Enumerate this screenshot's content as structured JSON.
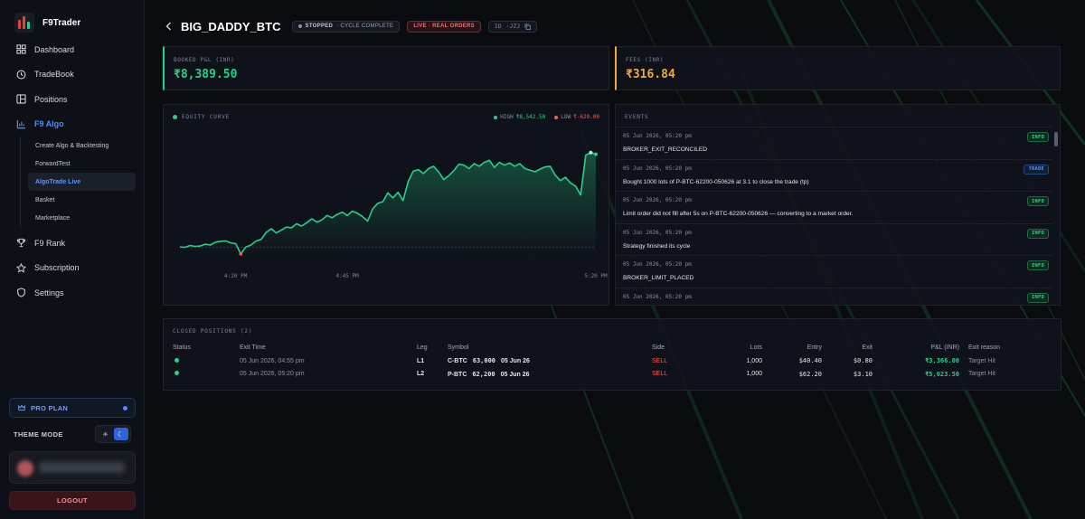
{
  "app": {
    "brand": "F9Trader"
  },
  "colors": {
    "accent": "#4f8cff",
    "profit": "#25d18a",
    "loss": "#ff5a5a",
    "fees": "#f0a93b"
  },
  "sidebar": {
    "items": [
      {
        "label": "Dashboard",
        "icon": "grid-icon"
      },
      {
        "label": "TradeBook",
        "icon": "history-icon"
      },
      {
        "label": "Positions",
        "icon": "layout-icon"
      },
      {
        "label": "F9 Algo",
        "icon": "bar-chart-icon",
        "active": true
      },
      {
        "label": "F9 Rank",
        "icon": "trophy-icon"
      },
      {
        "label": "Subscription",
        "icon": "star-icon"
      },
      {
        "label": "Settings",
        "icon": "shield-icon"
      }
    ],
    "algo_sub": [
      {
        "label": "Create Algo & Backtesting"
      },
      {
        "label": "ForwardTest"
      },
      {
        "label": "AlgoTrade Live",
        "active": true
      },
      {
        "label": "Basket"
      },
      {
        "label": "Marketplace"
      }
    ],
    "pro_plan": "PRO PLAN",
    "theme_mode": "THEME MODE",
    "logout": "LOGOUT"
  },
  "header": {
    "name": "BIG_DADDY_BTC",
    "status": "STOPPED",
    "status_sub": "· CYCLE COMPLETE",
    "live": "LIVE · REAL ORDERS",
    "id_label": "ID",
    "id_value": "·JZJ"
  },
  "kpi": {
    "booked_label": "BOOKED P&L (INR)",
    "booked_value": "₹8,389.50",
    "fees_label": "FEES (INR)",
    "fees_value": "₹316.84"
  },
  "equity": {
    "title": "EQUITY CURVE",
    "high_label": "HIGH",
    "high_value": "₹8,542.50",
    "low_label": "LOW",
    "low_value": "₹-629.00"
  },
  "chart_data": {
    "type": "area",
    "title": "EQUITY CURVE",
    "x_ticks": [
      "4:20 PM",
      "4:45 PM",
      "5:20 PM"
    ],
    "series": [
      {
        "points": [
          [
            0,
            0
          ],
          [
            1,
            -20
          ],
          [
            2,
            140
          ],
          [
            3,
            60
          ],
          [
            4,
            90
          ],
          [
            5,
            260
          ],
          [
            6,
            180
          ],
          [
            7,
            440
          ],
          [
            8,
            520
          ],
          [
            9,
            560
          ],
          [
            10,
            380
          ],
          [
            11,
            300
          ],
          [
            12,
            -629
          ],
          [
            13,
            0
          ],
          [
            14,
            180
          ],
          [
            15,
            540
          ],
          [
            16,
            700
          ],
          [
            17,
            1320
          ],
          [
            18,
            1650
          ],
          [
            19,
            1280
          ],
          [
            20,
            1540
          ],
          [
            21,
            1800
          ],
          [
            22,
            1740
          ],
          [
            23,
            2100
          ],
          [
            24,
            1900
          ],
          [
            25,
            2200
          ],
          [
            26,
            2550
          ],
          [
            27,
            2250
          ],
          [
            28,
            2450
          ],
          [
            29,
            2850
          ],
          [
            30,
            2650
          ],
          [
            31,
            2950
          ],
          [
            32,
            3150
          ],
          [
            33,
            2850
          ],
          [
            34,
            3250
          ],
          [
            35,
            3050
          ],
          [
            36,
            2750
          ],
          [
            37,
            2350
          ],
          [
            38,
            3450
          ],
          [
            39,
            3950
          ],
          [
            40,
            4100
          ],
          [
            41,
            4900
          ],
          [
            42,
            4450
          ],
          [
            43,
            4950
          ],
          [
            44,
            4200
          ],
          [
            45,
            5900
          ],
          [
            46,
            6850
          ],
          [
            47,
            7000
          ],
          [
            48,
            6650
          ],
          [
            49,
            7100
          ],
          [
            50,
            7300
          ],
          [
            51,
            6800
          ],
          [
            52,
            6100
          ],
          [
            53,
            6450
          ],
          [
            54,
            6900
          ],
          [
            55,
            7500
          ],
          [
            56,
            7400
          ],
          [
            57,
            7100
          ],
          [
            58,
            7550
          ],
          [
            59,
            7300
          ],
          [
            60,
            7650
          ],
          [
            61,
            7850
          ],
          [
            62,
            7200
          ],
          [
            63,
            7650
          ],
          [
            64,
            7400
          ],
          [
            65,
            7600
          ],
          [
            66,
            7300
          ],
          [
            67,
            7550
          ],
          [
            68,
            7100
          ],
          [
            69,
            6950
          ],
          [
            70,
            6800
          ],
          [
            71,
            7050
          ],
          [
            72,
            7250
          ],
          [
            73,
            7300
          ],
          [
            74,
            6500
          ],
          [
            75,
            6000
          ],
          [
            76,
            6300
          ],
          [
            77,
            5800
          ],
          [
            78,
            5500
          ],
          [
            79,
            4700
          ],
          [
            80,
            8300
          ],
          [
            81,
            8542.5
          ],
          [
            82,
            8389.5
          ]
        ]
      }
    ],
    "ylim": [
      -800,
      9500
    ],
    "baseline": 0,
    "grid": false
  },
  "events": {
    "title": "EVENTS",
    "items": [
      {
        "time": "05 Jun 2026, 05:20 pm",
        "text": "BROKER_EXIT_RECONCILED",
        "tag": "INFO",
        "kind": "info"
      },
      {
        "time": "05 Jun 2026, 05:20 pm",
        "text": "Bought 1000 lots of P-BTC-62200-050626 at 3.1 to close the trade (tp)",
        "tag": "TRADE",
        "kind": "trade"
      },
      {
        "time": "05 Jun 2026, 05:20 pm",
        "text": "Limit order did not fill after 5s on P-BTC-62200-050626 — converting to a market order.",
        "tag": "INFO",
        "kind": "info"
      },
      {
        "time": "05 Jun 2026, 05:20 pm",
        "text": "Strategy finished its cycle",
        "tag": "INFO",
        "kind": "info"
      },
      {
        "time": "05 Jun 2026, 05:20 pm",
        "text": "BROKER_LIMIT_PLACED",
        "tag": "INFO",
        "kind": "info"
      },
      {
        "time": "05 Jun 2026, 05:20 pm",
        "text": "",
        "tag": "INFO",
        "kind": "info"
      }
    ]
  },
  "closed": {
    "title": "CLOSED POSITIONS (2)",
    "headers": [
      "Status",
      "Exit Time",
      "Leg",
      "Symbol",
      "Side",
      "Lots",
      "Entry",
      "Exit",
      "P&L (INR)",
      "Exit reason"
    ],
    "rows": [
      {
        "exit_time": "05 Jun 2026, 04:55 pm",
        "leg": "L1",
        "symbol": "C-BTC",
        "strike": "63,000",
        "expiry": "05 Jun 26",
        "side": "SELL",
        "lots": "1,000",
        "entry": "$40.40",
        "exit": "$0.80",
        "pnl": "₹3,366.00",
        "reason": "Target Hit"
      },
      {
        "exit_time": "05 Jun 2026, 05:20 pm",
        "leg": "L2",
        "symbol": "P-BTC",
        "strike": "62,200",
        "expiry": "05 Jun 26",
        "side": "SELL",
        "lots": "1,000",
        "entry": "$62.20",
        "exit": "$3.10",
        "pnl": "₹5,023.50",
        "reason": "Target Hit"
      }
    ]
  }
}
